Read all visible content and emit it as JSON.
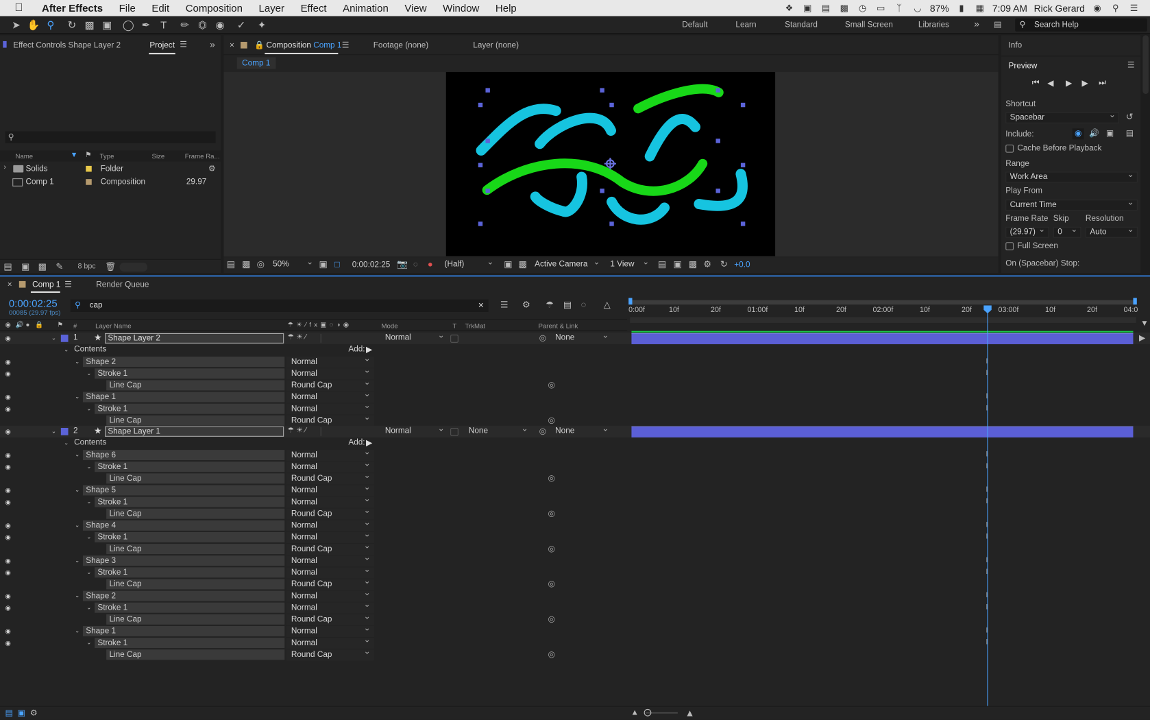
{
  "menubar": {
    "apple_icon": "apple-logo",
    "items": [
      "After Effects",
      "File",
      "Edit",
      "Composition",
      "Layer",
      "Effect",
      "Animation",
      "View",
      "Window",
      "Help"
    ],
    "battery": "87%",
    "time": "7:09 AM",
    "user": "Rick Gerard"
  },
  "toolbar": {
    "workspaces": [
      "Default",
      "Learn",
      "Standard",
      "Small Screen",
      "Libraries"
    ],
    "search_placeholder": "Search Help"
  },
  "project_panel": {
    "tab_effect_controls": "Effect Controls Shape Layer 2",
    "tab_project": "Project",
    "columns": [
      "Name",
      "Type",
      "Size",
      "Frame Ra..."
    ],
    "items": [
      {
        "name": "Solids",
        "type": "Folder",
        "size": "",
        "frame_rate": "",
        "label_color": "#e8c84a"
      },
      {
        "name": "Comp 1",
        "type": "Composition",
        "size": "",
        "frame_rate": "29.97",
        "label_color": "#b59a6e"
      }
    ],
    "bpc": "8 bpc"
  },
  "comp_panel": {
    "tab_prefix": "Composition",
    "tab_name": "Comp 1",
    "footage_tab": "Footage (none)",
    "layer_tab": "Layer (none)",
    "breadcrumb": "Comp 1",
    "zoom": "50%",
    "timecode": "0:00:02:25",
    "resolution": "(Half)",
    "camera": "Active Camera",
    "views": "1 View",
    "exposure": "+0.0",
    "colors": {
      "cyan": "#16c4e0",
      "green": "#18d818",
      "handle": "#5b63d8"
    }
  },
  "right_panel": {
    "info_tab": "Info",
    "preview_title": "Preview",
    "shortcut_label": "Shortcut",
    "shortcut_value": "Spacebar",
    "include_label": "Include:",
    "cache_label": "Cache Before Playback",
    "range_label": "Range",
    "range_value": "Work Area",
    "play_from_label": "Play From",
    "play_from_value": "Current Time",
    "frame_rate_label": "Frame Rate",
    "skip_label": "Skip",
    "resolution_label": "Resolution",
    "frame_rate_value": "(29.97)",
    "skip_value": "0",
    "resolution_value": "Auto",
    "full_screen_label": "Full Screen",
    "stop_label": "On (Spacebar) Stop:"
  },
  "timeline": {
    "tab_comp": "Comp 1",
    "tab_render": "Render Queue",
    "timecode": "0:00:02:25",
    "frame_info": "00085 (29.97 fps)",
    "search_value": "cap",
    "headers": {
      "hash": "#",
      "layer_name": "Layer Name",
      "mode": "Mode",
      "t": "T",
      "trkmat": "TrkMat",
      "parent": "Parent & Link"
    },
    "ruler": [
      "0:00f",
      "10f",
      "20f",
      "01:00f",
      "10f",
      "20f",
      "02:00f",
      "10f",
      "20f",
      "03:00f",
      "10f",
      "20f",
      "04:0"
    ],
    "add_label": "Add:",
    "layers": [
      {
        "index": "1",
        "name": "Shape Layer 2",
        "mode": "Normal",
        "trkmat": "",
        "parent": "None"
      },
      {
        "index": "2",
        "name": "Shape Layer 1",
        "mode": "Normal",
        "trkmat": "None",
        "parent": "None"
      }
    ],
    "contents_label": "Contents",
    "stroke_label": "Stroke 1",
    "linecap_label": "Line Cap",
    "mode_normal": "Normal",
    "cap_value": "Round Cap",
    "layer2_shapes": [
      "Shape 2",
      "Shape 1"
    ],
    "layer1_shapes": [
      "Shape 6",
      "Shape 5",
      "Shape 4",
      "Shape 3",
      "Shape 2",
      "Shape 1"
    ]
  }
}
